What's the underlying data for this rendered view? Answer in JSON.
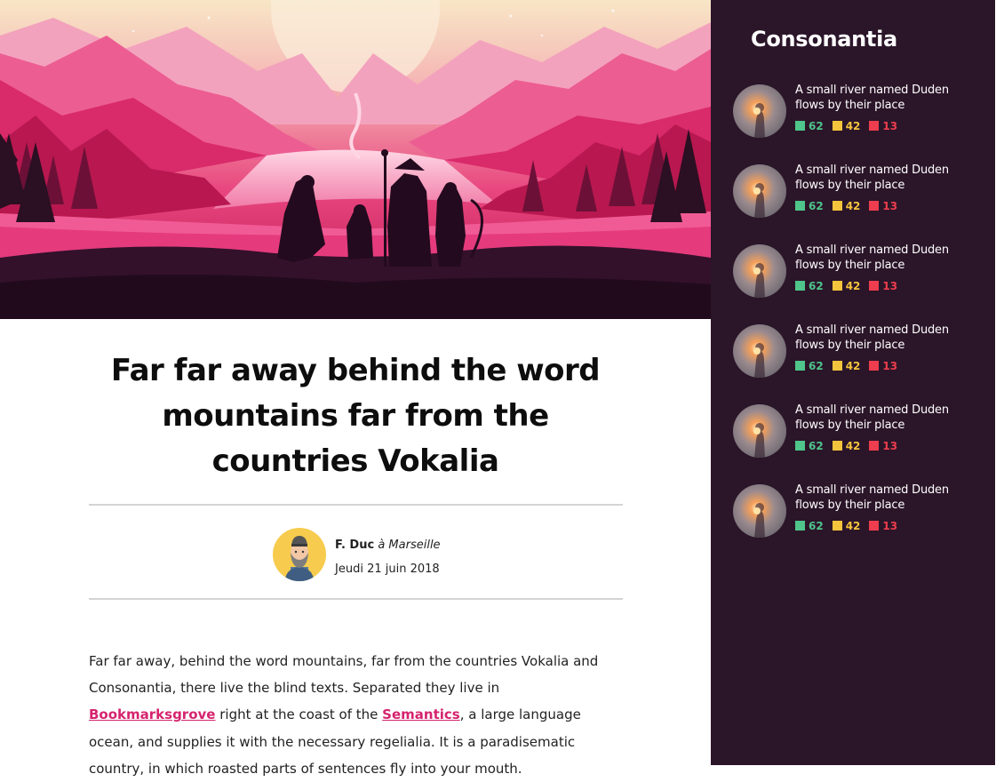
{
  "article": {
    "title": "Far far away behind the word mountains far from the countries Vokalia",
    "author": {
      "name": "F. Duc",
      "location": "à Marseille",
      "date": "Jeudi 21 juin 2018"
    },
    "body": {
      "part1": "Far far away, behind the word mountains, far from the countries Vokalia and Consonantia, there live the blind texts. Separated they live in ",
      "link1": "Bookmarksgrove",
      "part2": " right at the coast of the ",
      "link2": "Semantics",
      "part3": ", a large language ocean, and supplies it with the necessary regelialia. It is a paradisematic country, in which roasted parts of sentences fly into your mouth."
    }
  },
  "sidebar": {
    "title": "Consonantia",
    "items": [
      {
        "text": "A small river named Duden flows by their place",
        "green": "62",
        "yellow": "42",
        "red": "13"
      },
      {
        "text": "A small river named Duden flows by their place",
        "green": "62",
        "yellow": "42",
        "red": "13"
      },
      {
        "text": "A small river named Duden flows by their place",
        "green": "62",
        "yellow": "42",
        "red": "13"
      },
      {
        "text": "A small river named Duden flows by their place",
        "green": "62",
        "yellow": "42",
        "red": "13"
      },
      {
        "text": "A small river named Duden flows by their place",
        "green": "62",
        "yellow": "42",
        "red": "13"
      },
      {
        "text": "A small river named Duden flows by their place",
        "green": "62",
        "yellow": "42",
        "red": "13"
      }
    ]
  },
  "colors": {
    "sidebar_bg": "#2b1529",
    "link": "#d6236e",
    "stat_green": "#4fc48b",
    "stat_yellow": "#f4c43c",
    "stat_red": "#ee3d4e"
  },
  "icons": {
    "hero": "mountain-landscape-illustration",
    "avatar": "bearded-man-avatar",
    "thumbnail": "glowing-figure-thumbnail"
  }
}
